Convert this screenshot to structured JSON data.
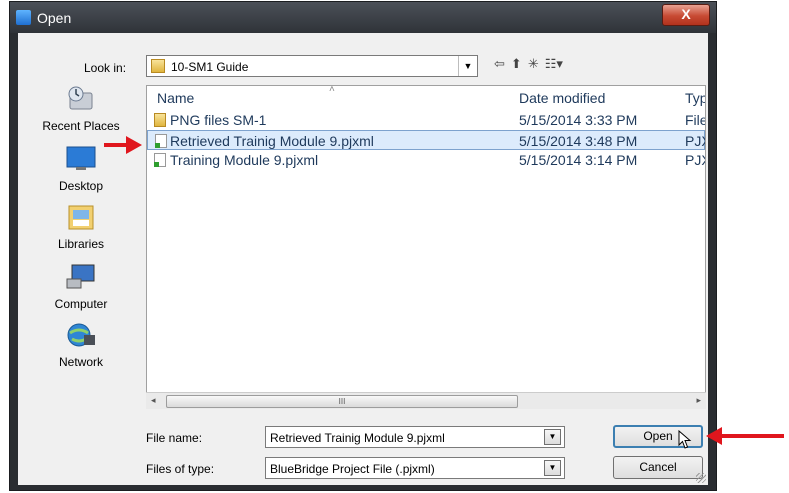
{
  "window": {
    "title": "Open",
    "close_glyph": "X"
  },
  "lookin": {
    "label": "Look in:",
    "value": "10-SM1 Guide",
    "dropdown_glyph": "▼"
  },
  "toolbar": {
    "back": "⇦",
    "up": "⬆",
    "newfolder": "✳",
    "views": "☷▾"
  },
  "places": [
    {
      "label": "Recent Places",
      "icon": "recent-places-icon"
    },
    {
      "label": "Desktop",
      "icon": "desktop-icon"
    },
    {
      "label": "Libraries",
      "icon": "libraries-icon"
    },
    {
      "label": "Computer",
      "icon": "computer-icon"
    },
    {
      "label": "Network",
      "icon": "network-icon"
    }
  ],
  "columns": {
    "name": "Name",
    "date": "Date modified",
    "type": "Typ",
    "sort_glyph": "˄"
  },
  "files": [
    {
      "name": "PNG files SM-1",
      "date": "5/15/2014 3:33 PM",
      "type": "File",
      "kind": "folder"
    },
    {
      "name": "Retrieved Trainig Module 9.pjxml",
      "date": "5/15/2014 3:48 PM",
      "type": "PJX",
      "kind": "file"
    },
    {
      "name": "Training Module 9.pjxml",
      "date": "5/15/2014 3:14 PM",
      "type": "PJX",
      "kind": "file"
    }
  ],
  "scroll": {
    "left": "◂",
    "right": "▸",
    "thumb": "III"
  },
  "form": {
    "filename_label": "File name:",
    "filename_value": "Retrieved Trainig Module 9.pjxml",
    "filetype_label": "Files of type:",
    "filetype_value": "BlueBridge Project File (.pjxml)",
    "dd_glyph": "▼"
  },
  "buttons": {
    "open": "Open",
    "cancel": "Cancel"
  },
  "colors": {
    "annotation_arrow": "#e0161d",
    "selection": "#dcebfc"
  }
}
